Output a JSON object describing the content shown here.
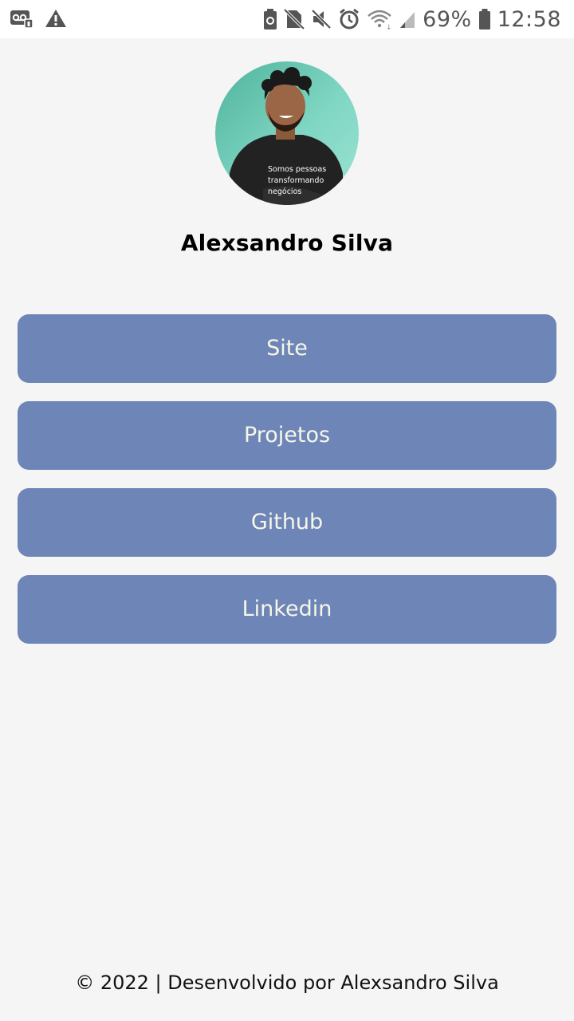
{
  "status_bar": {
    "battery_percent": "69%",
    "time": "12:58",
    "icons": [
      "voicemail-icon",
      "warning-icon",
      "battery-saver-icon",
      "no-sim-icon",
      "mute-icon",
      "alarm-icon",
      "wifi-icon",
      "signal-icon",
      "battery-icon"
    ]
  },
  "profile": {
    "name": "Alexsandro Silva",
    "shirt_text": [
      "Somos pessoas",
      "transformando",
      "negócios"
    ]
  },
  "links": [
    {
      "label": "Site"
    },
    {
      "label": "Projetos"
    },
    {
      "label": "Github"
    },
    {
      "label": "Linkedin"
    }
  ],
  "footer": {
    "text": "© 2022 | Desenvolvido por Alexsandro Silva"
  },
  "colors": {
    "background": "#f5f5f5",
    "button": "#6e85b7",
    "button_text": "#f7f7e8"
  }
}
